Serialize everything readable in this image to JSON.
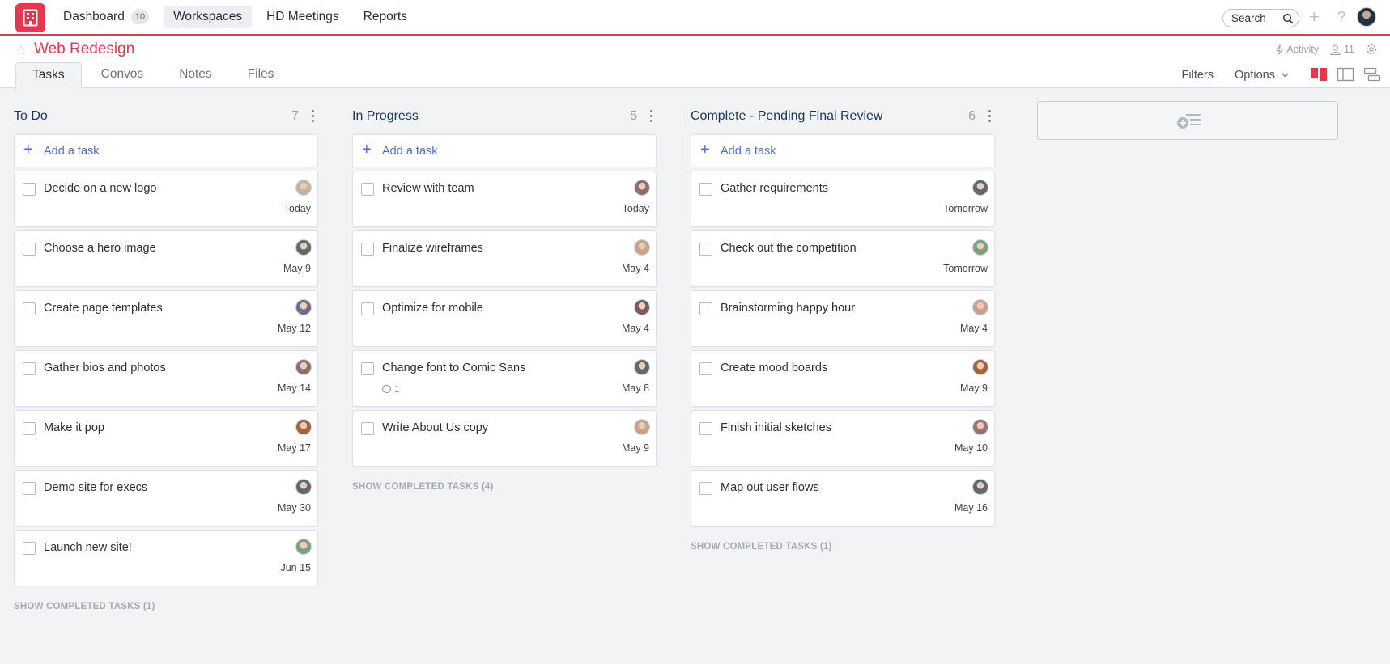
{
  "topbar": {
    "nav": [
      {
        "label": "Dashboard",
        "badge": "10"
      },
      {
        "label": "Workspaces"
      },
      {
        "label": "HD Meetings"
      },
      {
        "label": "Reports"
      }
    ],
    "search_placeholder": "Search",
    "icons": [
      "plus-icon",
      "help-icon"
    ],
    "brand_color": "#e8364d"
  },
  "project": {
    "title": "Web Redesign",
    "activity_label": "Activity",
    "members_count": "11"
  },
  "tabs": [
    "Tasks",
    "Convos",
    "Notes",
    "Files"
  ],
  "toolbar": {
    "filters_label": "Filters",
    "options_label": "Options"
  },
  "columns": [
    {
      "title": "To Do",
      "count": "7",
      "add_label": "Add a task",
      "tasks": [
        {
          "name": "Decide on a new logo",
          "due": "Today",
          "avatar": "#c7b1a3"
        },
        {
          "name": "Choose a hero image",
          "due": "May 9",
          "avatar": "#5e6a6e"
        },
        {
          "name": "Create page templates",
          "due": "May 12",
          "avatar": "#6d6a8a"
        },
        {
          "name": "Gather bios and photos",
          "due": "May 14",
          "avatar": "#8c6f6a"
        },
        {
          "name": "Make it pop",
          "due": "May 17",
          "avatar": "#a4633e"
        },
        {
          "name": "Demo site for execs",
          "due": "May 30",
          "avatar": "#5a6a70"
        },
        {
          "name": "Launch new site!",
          "due": "Jun 15",
          "avatar": "#7aa27e"
        }
      ],
      "show_completed": "SHOW COMPLETED TASKS (1)"
    },
    {
      "title": "In Progress",
      "count": "5",
      "add_label": "Add a task",
      "tasks": [
        {
          "name": "Review with team",
          "due": "Today",
          "avatar": "#8c6f6a"
        },
        {
          "name": "Finalize wireframes",
          "due": "May 4",
          "avatar": "#c8a38a"
        },
        {
          "name": "Optimize for mobile",
          "due": "May 4",
          "avatar": "#7b5b5b"
        },
        {
          "name": "Change font to Comic Sans",
          "due": "May 8",
          "avatar": "#5e6a6e",
          "comments": "1"
        },
        {
          "name": "Write About Us copy",
          "due": "May 9",
          "avatar": "#c8a38a"
        }
      ],
      "show_completed": "SHOW COMPLETED TASKS (4)"
    },
    {
      "title": "Complete - Pending Final Review",
      "count": "6",
      "add_label": "Add a task",
      "tasks": [
        {
          "name": "Gather requirements",
          "due": "Tomorrow",
          "avatar": "#5e6a6e"
        },
        {
          "name": "Check out the competition",
          "due": "Tomorrow",
          "avatar": "#7aa27e"
        },
        {
          "name": "Brainstorming happy hour",
          "due": "May 4",
          "avatar": "#c7a090"
        },
        {
          "name": "Create mood boards",
          "due": "May 9",
          "avatar": "#a4633e"
        },
        {
          "name": "Finish initial sketches",
          "due": "May 10",
          "avatar": "#9a7378"
        },
        {
          "name": "Map out user flows",
          "due": "May 16",
          "avatar": "#5e6a6e"
        }
      ],
      "show_completed": "SHOW COMPLETED TASKS (1)"
    }
  ]
}
